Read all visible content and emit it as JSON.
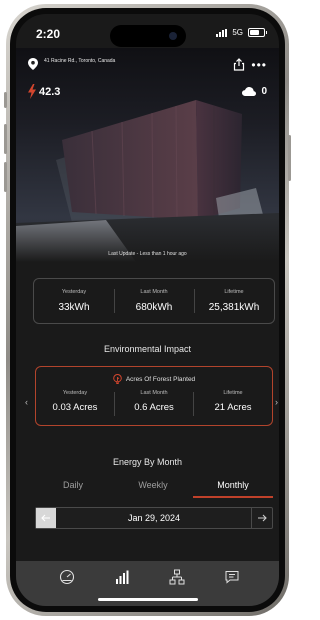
{
  "status": {
    "time": "2:20",
    "network": "5G"
  },
  "site": {
    "address": "41 Racine Rd., Toronto, Canada"
  },
  "header": {
    "power_value": "42.3",
    "weather_value": "0",
    "icons": [
      "location-pin-icon",
      "share-icon",
      "more-icon",
      "lightning-bolt-icon",
      "cloud-icon"
    ]
  },
  "hero": {
    "last_update": "Last Update - Less than 1 hour ago"
  },
  "stats": [
    {
      "label": "Yesterday",
      "value": "33kWh"
    },
    {
      "label": "Last Month",
      "value": "680kWh"
    },
    {
      "label": "Lifetime",
      "value": "25,381kWh"
    }
  ],
  "environmental": {
    "title": "Environmental Impact",
    "card_title": "Acres Of Forest Planted",
    "items": [
      {
        "label": "Yesterday",
        "value": "0.03 Acres"
      },
      {
        "label": "Last Month",
        "value": "0.6 Acres"
      },
      {
        "label": "Lifetime",
        "value": "21 Acres"
      }
    ]
  },
  "energy": {
    "title": "Energy By Month",
    "tabs": [
      {
        "label": "Daily",
        "active": false
      },
      {
        "label": "Weekly",
        "active": false
      },
      {
        "label": "Monthly",
        "active": true
      }
    ],
    "date": "Jan 29, 2024"
  },
  "nav": [
    "dashboard-gauge-icon",
    "bar-chart-icon",
    "hierarchy-icon",
    "message-icon"
  ],
  "colors": {
    "accent": "#c0412a",
    "background": "#1a1a1a",
    "card_border": "#4a4a4a",
    "tab_bar": "#3b3b3b"
  }
}
